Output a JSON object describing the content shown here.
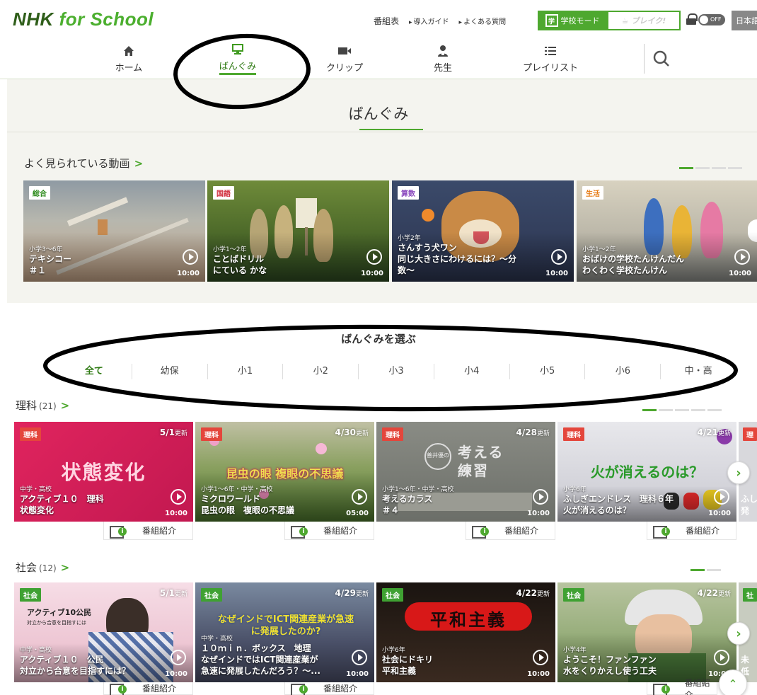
{
  "header": {
    "logo_nhk": "NHK",
    "logo_for_school": "for School",
    "links": [
      "番組表",
      "導入ガイド",
      "よくある質問"
    ],
    "school_mode_icon": "学",
    "school_mode": "学校モード",
    "break_label": "ブレイク!",
    "toggle": "OFF",
    "lang": "日本語"
  },
  "nav": {
    "items": [
      {
        "label": "ホーム",
        "icon": "home-icon"
      },
      {
        "label": "ばんぐみ",
        "icon": "monitor-icon"
      },
      {
        "label": "クリップ",
        "icon": "video-camera-icon"
      },
      {
        "label": "先生",
        "icon": "teacher-icon"
      },
      {
        "label": "プレイリスト",
        "icon": "list-icon"
      }
    ],
    "active": "ばんぐみ",
    "search_icon": "search-icon"
  },
  "page": {
    "title": "ばんぐみ"
  },
  "popular": {
    "title": "よく見られている動画",
    "chevron": ">",
    "cards": [
      {
        "subject": "総合",
        "grade": "小学3〜6年",
        "title1": "テキシコー",
        "title2": "＃１",
        "duration": "10:00"
      },
      {
        "subject": "国語",
        "grade": "小学1〜2年",
        "title1": "ことばドリル",
        "title2": "にている かな",
        "duration": "10:00"
      },
      {
        "subject": "算数",
        "grade": "小学2年",
        "title1": "さんすう犬ワン",
        "title2": "同じ大きさにわけるには？〜分",
        "title3": "数〜",
        "duration": "10:00"
      },
      {
        "subject": "生活",
        "grade": "小学1〜2年",
        "title1": "おばけの学校たんけんだん",
        "title2": "わくわく学校たんけん",
        "duration": "10:00"
      }
    ]
  },
  "select": {
    "title": "ばんぐみを選ぶ",
    "grades": [
      "全て",
      "幼保",
      "小1",
      "小2",
      "小3",
      "小4",
      "小5",
      "小6",
      "中・高"
    ],
    "active": "全て"
  },
  "science": {
    "name": "理科",
    "count": "(21)",
    "chevron": ">",
    "cards": [
      {
        "subject": "理科",
        "updated": "5/1",
        "updated_suffix": "更新",
        "overlay": "状態変化",
        "grade": "中学・高校",
        "title1": "アクティブ１０　理科",
        "title2": "状態変化",
        "duration": "10:00"
      },
      {
        "subject": "理科",
        "updated": "4/30",
        "updated_suffix": "更新",
        "overlay": "昆虫の眼 複眼の不思議",
        "grade": "小学1〜6年・中学・高校",
        "title1": "ミクロワールド",
        "title2": "昆虫の眼　複眼の不思議",
        "duration": "05:00"
      },
      {
        "subject": "理科",
        "updated": "4/28",
        "updated_suffix": "更新",
        "overlay": "考える練習",
        "overlay_small": "善井優の",
        "grade": "小学1〜6年・中学・高校",
        "title1": "考えるカラス",
        "title2": "＃４",
        "duration": "10:00"
      },
      {
        "subject": "理科",
        "updated": "4/21",
        "updated_suffix": "更新",
        "overlay": "火が消えるのは？",
        "grade": "小学6年",
        "title1": "ふしぎエンドレス　理科６年",
        "title2": "火が消えるのは？",
        "duration": "10:00"
      }
    ],
    "peek": {
      "subject": "理",
      "t1": "ふし",
      "t2": "発"
    },
    "intro_label": "番組紹介"
  },
  "social": {
    "name": "社会",
    "count": "(12)",
    "chevron": ">",
    "cards": [
      {
        "subject": "社会",
        "updated": "5/1",
        "updated_suffix": "更新",
        "overlay": "アクティブ10公民",
        "overlay_small": "対立から合意を目指すには",
        "grade": "中学・高校",
        "title1": "アクティブ１０　公民",
        "title2": "対立から合意を目指すには？",
        "duration": "10:00"
      },
      {
        "subject": "社会",
        "updated": "4/29",
        "updated_suffix": "更新",
        "overlay": "なぜインドでICT関連産業が急速に発展したのか?",
        "grade": "中学・高校",
        "title1": "１０ｍｉｎ．ボックス　地理",
        "title2": "なぜインドではICT関連産業が",
        "title3": "急速に発展したんだろう？〜...",
        "duration": "10:00"
      },
      {
        "subject": "社会",
        "updated": "4/22",
        "updated_suffix": "更新",
        "overlay": "平和主義",
        "grade": "小学6年",
        "title1": "社会にドキリ",
        "title2": "平和主義",
        "duration": "10:00"
      },
      {
        "subject": "社会",
        "updated": "4/22",
        "updated_suffix": "更新",
        "grade": "小学4年",
        "title1": "ようこそ！ファンファン",
        "title2": "水をくりかえし使う工夫",
        "duration": "10:00"
      }
    ],
    "peek": {
      "subject": "社",
      "t1": "未",
      "t2": "低"
    },
    "intro_label": "番組紹介"
  },
  "colors": {
    "accent": "#4ea82f",
    "brand_dark": "#2f5e1a",
    "annotation": "#000000"
  },
  "icons": {
    "next": "chevron-right-icon",
    "to_top": "chevron-up-icon",
    "play": "play-circle-icon",
    "intro": "program-info-icon"
  }
}
